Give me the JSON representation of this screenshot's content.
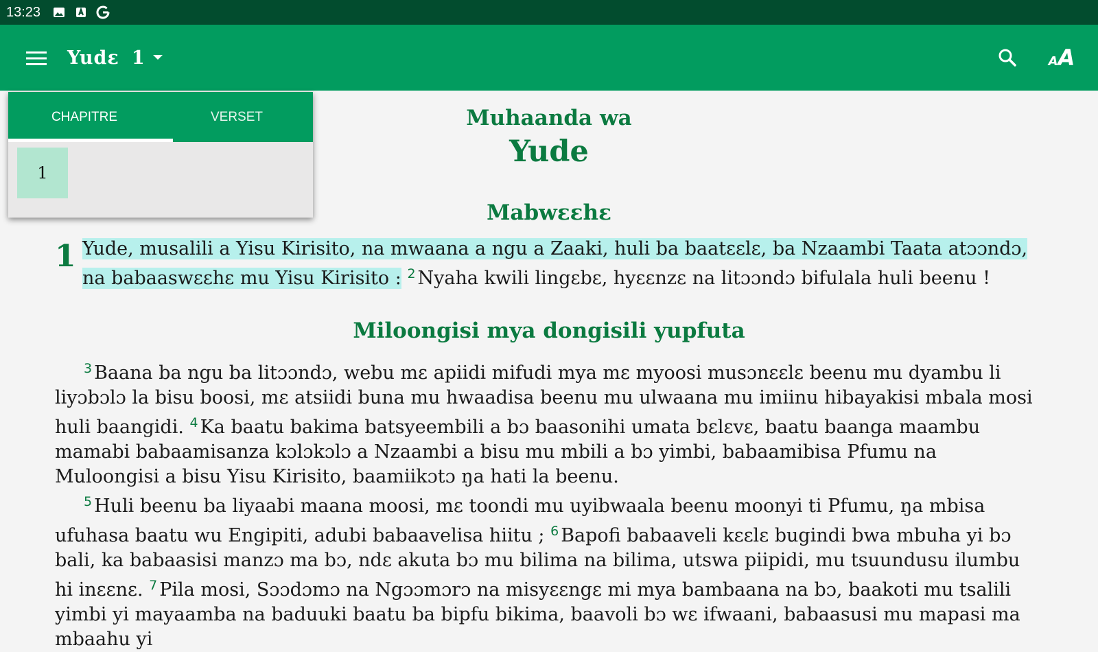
{
  "status_bar": {
    "time": "13:23",
    "icons": [
      "image-icon",
      "a-box-icon",
      "google-icon"
    ]
  },
  "app_bar": {
    "book": "Yudɛ",
    "chapter": "1",
    "icons": [
      "menu-icon",
      "chevron-down-icon",
      "search-icon",
      "text-size-icon"
    ],
    "font_label_small": "A",
    "font_label_large": "A"
  },
  "selector_panel": {
    "tabs": [
      {
        "label": "CHAPITRE",
        "selected": true
      },
      {
        "label": "VERSET",
        "selected": false
      }
    ],
    "chapters": [
      "1"
    ]
  },
  "colors": {
    "status_bar": "#024c2e",
    "app_bar": "#029c5f",
    "heading_green": "#0b7a40",
    "highlight": "#b7f0ec",
    "selected_chapter": "#b2e6d0"
  },
  "content": {
    "book_subtitle": "Muhaanda wa",
    "book_title": "Yude",
    "heading1": "Mabwɛɛhɛ",
    "chapter_number": "1",
    "p1": {
      "v1_text": "Yude, musalili a Yisu Kirisito, na mwaana a ngu a Zaaki, huli ba baatɛɛlɛ, ba Nzaambi Taata atɔɔndɔ, na babaaswɛɛhɛ mu Yisu Kirisito :",
      "v2_num": "2",
      "v2_text": "Nyaha kwili lingɛbɛ, hyɛɛnzɛ na litɔɔndɔ bifulala huli beenu !"
    },
    "heading2": "Miloongisi mya dongisili yupfuta",
    "p2": {
      "v3_num": "3",
      "v3_text": "Baana ba ngu ba litɔɔndɔ, webu mɛ apiidi mifudi mya mɛ myoosi musɔnɛɛlɛ beenu mu dyambu li liyɔbɔlɔ la bisu boosi, mɛ atsiidi buna mu hwaadisa beenu mu ulwaana mu imiinu hibayakisi mbala mosi huli baangidi.",
      "v4_num": "4",
      "v4_text": "Ka baatu bakima batsyeembili a bɔ baasonihi umata bɛlɛvɛ, baatu baanga maambu mamabi babaamisanza kɔlɔkɔlɔ a Nzaambi a bisu mu mbili a bɔ yimbi, babaamibisa Pfumu na Muloongisi a bisu Yisu Kirisito, baamiikɔtɔ ŋa hati la beenu."
    },
    "p3": {
      "v5_num": "5",
      "v5_text": "Huli beenu ba liyaabi maana moosi, mɛ toondi mu uyibwaala beenu moonyi ti Pfumu, ŋa mbisa ufuhasa baatu wu Engipiti, adubi babaavelisa hiitu ;",
      "v6_num": "6",
      "v6_text": "Bapofi babaaveli kɛɛlɛ bugindi bwa mbuha yi bɔ bali, ka babaasisi manzɔ ma bɔ, ndɛ akuta bɔ mu bilima na bilima, utswa piipidi, mu tsuundusu ilumbu hi inɛɛnɛ.",
      "v7_num": "7",
      "v7_text": "Pila mosi, Sɔɔdɔmɔ na Ngɔɔmɔrɔ na misyɛɛngɛ mi mya bambaana na bɔ, baakoti mu tsalili yimbi yi mayaamba na baduuki baatu ba bipfu bikima, baavoli bɔ wɛ ifwaani, babaasusi mu mapasi ma mbaahu yi"
    }
  }
}
